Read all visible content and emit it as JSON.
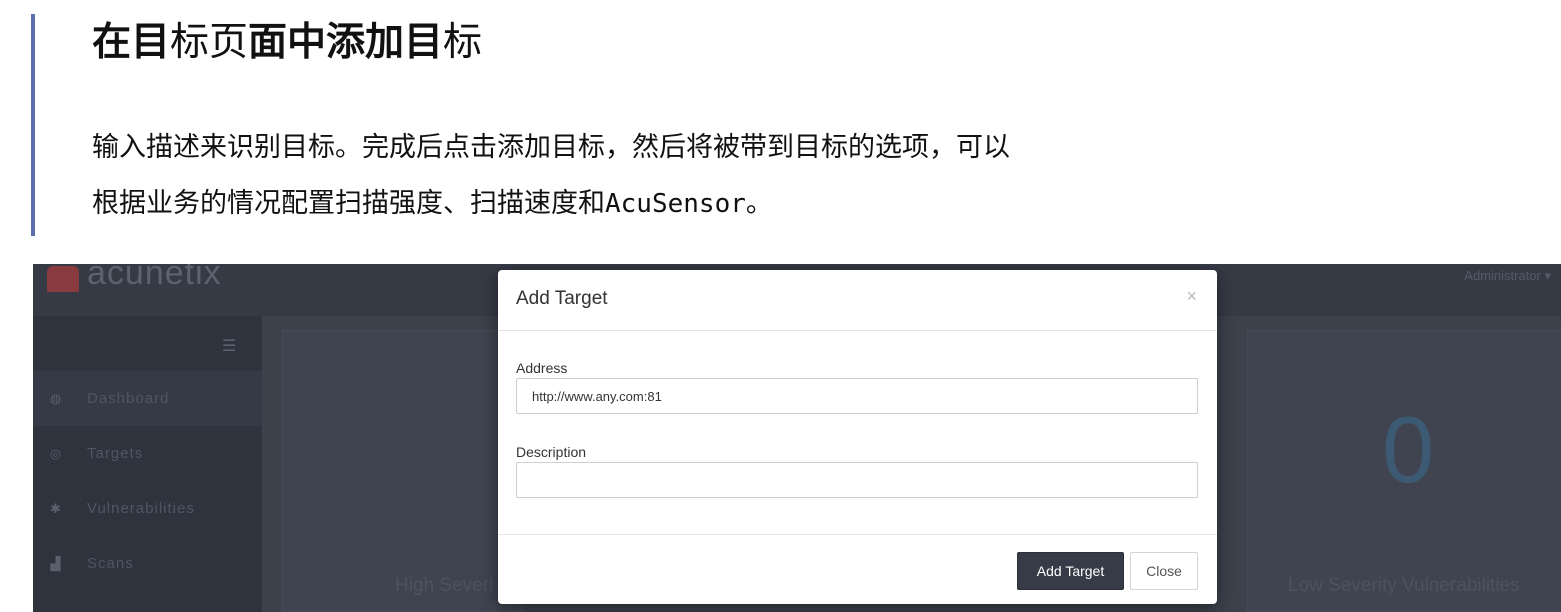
{
  "article": {
    "title_parts": [
      "在目",
      "标页",
      "面中添加目",
      "标"
    ],
    "body_line1": "输入描述来识别目标。完成后点击添加目标，然后将被带到目标的选项，可以",
    "body_line2_prefix": "根据业务的情况配置扫描强度、扫描速度和",
    "body_line2_mono": "AcuSensor",
    "body_line2_suffix": "。"
  },
  "app": {
    "logo_text": "acunetix",
    "user_menu": "Administrator ▾",
    "sidebar": {
      "toggle_icon": "menu-collapse-icon",
      "items": [
        {
          "label": "Dashboard",
          "icon": "dashboard-icon",
          "glyph": "◍"
        },
        {
          "label": "Targets",
          "icon": "target-icon",
          "glyph": "◎"
        },
        {
          "label": "Vulnerabilities",
          "icon": "bug-icon",
          "glyph": "✱"
        },
        {
          "label": "Scans",
          "icon": "chart-icon",
          "glyph": "▟"
        }
      ]
    },
    "dashboard": {
      "card_left_label": "High Severi",
      "card_right_label": "Low Severity Vulnerabilities",
      "low_count": "0"
    }
  },
  "modal": {
    "title": "Add Target",
    "close_glyph": "×",
    "address_label": "Address",
    "address_value": "http://www.any.com:81",
    "description_label": "Description",
    "description_value": "",
    "submit_label": "Add Target",
    "close_label": "Close"
  },
  "colors": {
    "accent_bar": "#5b6fae",
    "primary_button": "#363b47",
    "sidebar_bg": "#2f333d",
    "topbar_bg": "#363a45"
  }
}
